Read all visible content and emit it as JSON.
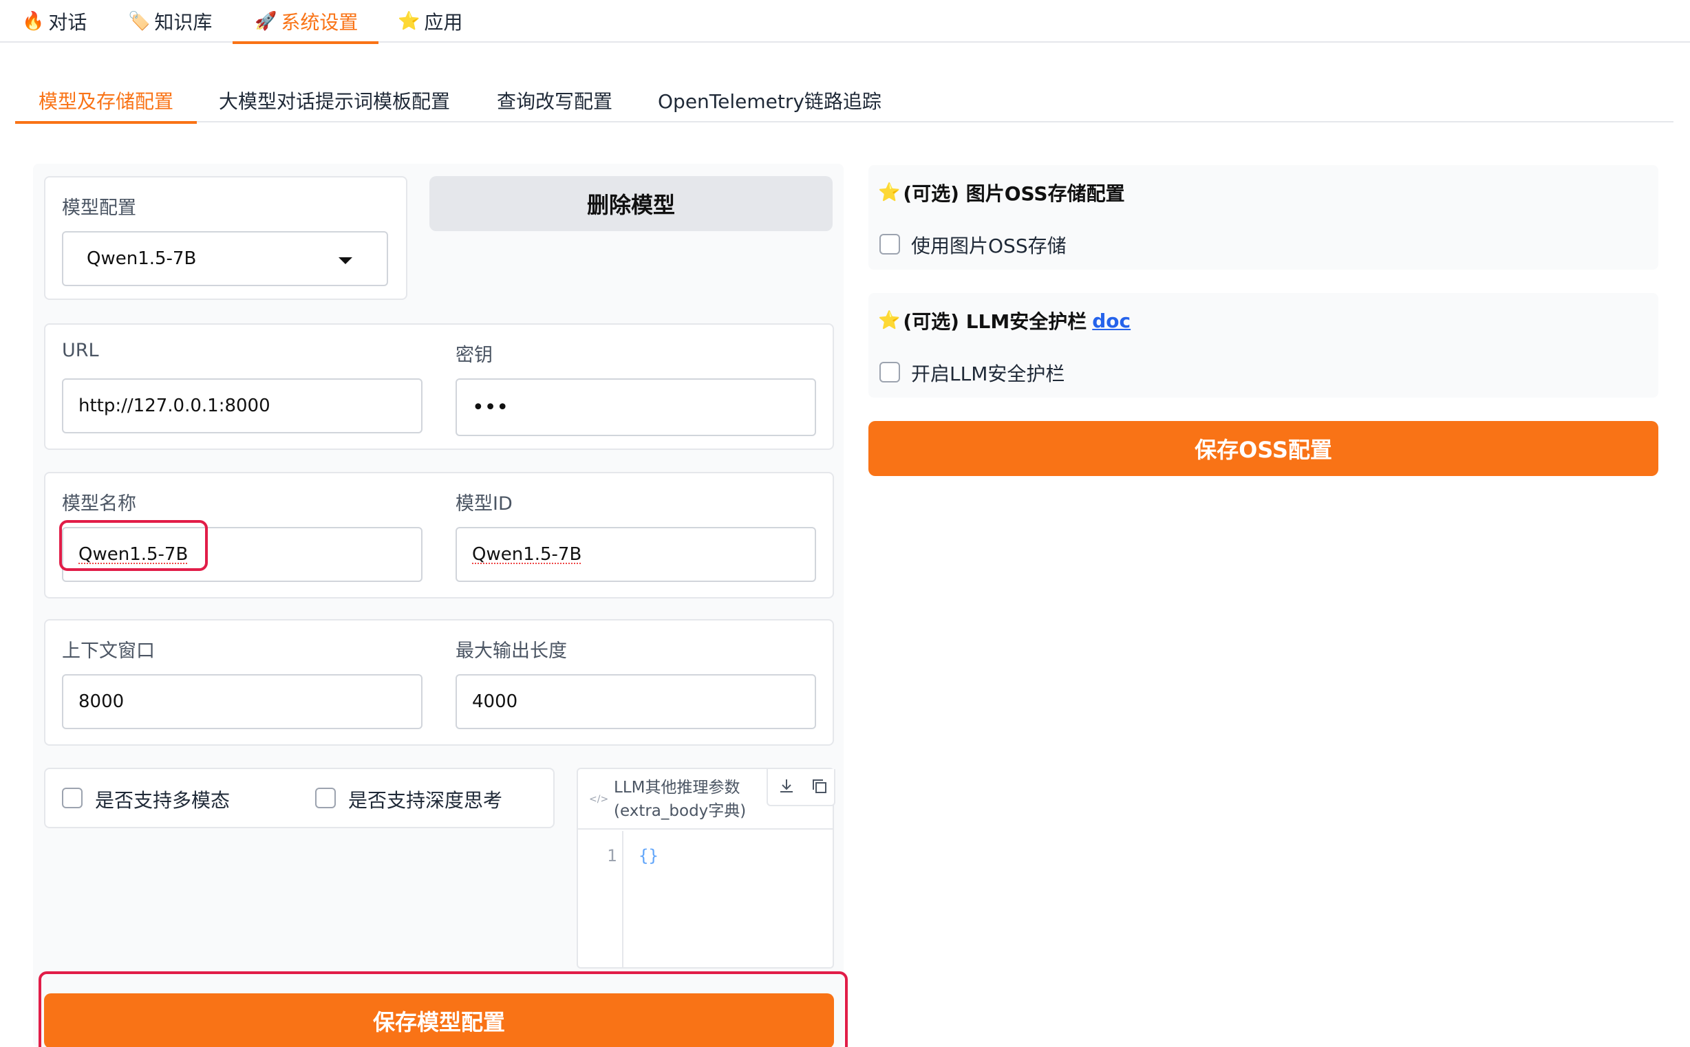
{
  "top_tabs": [
    {
      "icon": "🔥",
      "icon_name": "fire-icon",
      "label": "对话"
    },
    {
      "icon": "🏷️",
      "icon_name": "tag-icon",
      "label": "知识库"
    },
    {
      "icon": "🚀",
      "icon_name": "rocket-icon",
      "label": "系统设置"
    },
    {
      "icon": "⭐",
      "icon_name": "star-icon",
      "label": "应用"
    }
  ],
  "sub_tabs": [
    {
      "label": "模型及存储配置"
    },
    {
      "label": "大模型对话提示词模板配置"
    },
    {
      "label": "查询改写配置"
    },
    {
      "label": "OpenTelemetry链路追踪"
    }
  ],
  "model_config": {
    "label": "模型配置",
    "selected": "Qwen1.5-7B",
    "delete_button": "删除模型"
  },
  "url": {
    "label": "URL",
    "value": "http://127.0.0.1:8000"
  },
  "secret": {
    "label": "密钥",
    "value": "•••"
  },
  "model_name": {
    "label": "模型名称",
    "value": "Qwen1.5-7B"
  },
  "model_id": {
    "label": "模型ID",
    "value": "Qwen1.5-7B"
  },
  "context_window": {
    "label": "上下文窗口",
    "value": "8000"
  },
  "max_output": {
    "label": "最大输出长度",
    "value": "4000"
  },
  "checkboxes": {
    "multimodal": "是否支持多模态",
    "deep_thinking": "是否支持深度思考"
  },
  "extra_body": {
    "label": "LLM其他推理参数(extra_body字典)",
    "line_number": "1",
    "content": "{}"
  },
  "save_model_button": "保存模型配置",
  "oss": {
    "title": "(可选) 图片OSS存储配置",
    "checkbox": "使用图片OSS存储"
  },
  "guardrail": {
    "title": "(可选) LLM安全护栏",
    "link": "doc",
    "checkbox": "开启LLM安全护栏"
  },
  "save_oss_button": "保存OSS配置",
  "colors": {
    "accent": "#f97316",
    "highlight": "#e11d48",
    "link": "#2563eb"
  }
}
